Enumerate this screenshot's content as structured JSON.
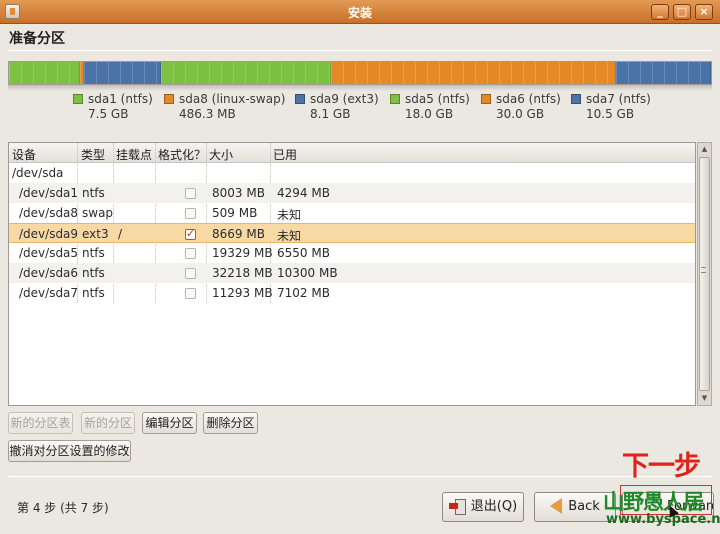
{
  "window": {
    "title": "安装"
  },
  "page": {
    "heading": "准备分区"
  },
  "partition_bar": {
    "segments": [
      {
        "name": "sda1",
        "color": "#7cc142",
        "fraction": 0.1007
      },
      {
        "name": "sda8",
        "color": "#e48828",
        "fraction": 0.0064
      },
      {
        "name": "sda9",
        "color": "#4a73a8",
        "fraction": 0.109
      },
      {
        "name": "sda5",
        "color": "#7cc142",
        "fraction": 0.243
      },
      {
        "name": "sda6",
        "color": "#e48828",
        "fraction": 0.405
      },
      {
        "name": "sda7",
        "color": "#4a73a8",
        "fraction": 0.1359
      }
    ]
  },
  "legend": [
    {
      "label": "sda1 (ntfs)",
      "size": "7.5 GB",
      "color": "#7cc142"
    },
    {
      "label": "sda8 (linux-swap)",
      "size": "486.3 MB",
      "color": "#e48828"
    },
    {
      "label": "sda9 (ext3)",
      "size": "8.1 GB",
      "color": "#4a73a8"
    },
    {
      "label": "sda5 (ntfs)",
      "size": "18.0 GB",
      "color": "#7cc142"
    },
    {
      "label": "sda6 (ntfs)",
      "size": "30.0 GB",
      "color": "#e48828"
    },
    {
      "label": "sda7 (ntfs)",
      "size": "10.5 GB",
      "color": "#4a73a8"
    }
  ],
  "table": {
    "headers": {
      "device": "设备",
      "type": "类型",
      "mount": "挂载点",
      "format": "格式化？",
      "size": "大小",
      "used": "已用"
    },
    "rows": [
      {
        "device": "/dev/sda",
        "type": "",
        "mount": "",
        "format": null,
        "size": "",
        "used": ""
      },
      {
        "device": "/dev/sda1",
        "type": "ntfs",
        "mount": "",
        "format": false,
        "size": "8003 MB",
        "used": "4294 MB"
      },
      {
        "device": "/dev/sda8",
        "type": "swap",
        "mount": "",
        "format": false,
        "size": "509 MB",
        "used": "未知"
      },
      {
        "device": "/dev/sda9",
        "type": "ext3",
        "mount": "/",
        "format": true,
        "size": "8669 MB",
        "used": "未知",
        "selected": true
      },
      {
        "device": "/dev/sda5",
        "type": "ntfs",
        "mount": "",
        "format": false,
        "size": "19329 MB",
        "used": "6550 MB"
      },
      {
        "device": "/dev/sda6",
        "type": "ntfs",
        "mount": "",
        "format": false,
        "size": "32218 MB",
        "used": "10300 MB"
      },
      {
        "device": "/dev/sda7",
        "type": "ntfs",
        "mount": "",
        "format": false,
        "size": "11293 MB",
        "used": "7102 MB"
      }
    ]
  },
  "actions": {
    "new_table": "新的分区表",
    "new_partition": "新的分区",
    "edit_partition": "编辑分区",
    "delete_partition": "删除分区",
    "revert": "撤消对分区设置的修改"
  },
  "footer": {
    "step": "第 4 步 (共 7 步)",
    "quit": "退出(Q)",
    "back": "Back",
    "forward": "Forward"
  },
  "overlay": {
    "next_label": "下一步",
    "watermark_brand": "山野愚人居",
    "watermark_url": "www.byspace.net"
  }
}
